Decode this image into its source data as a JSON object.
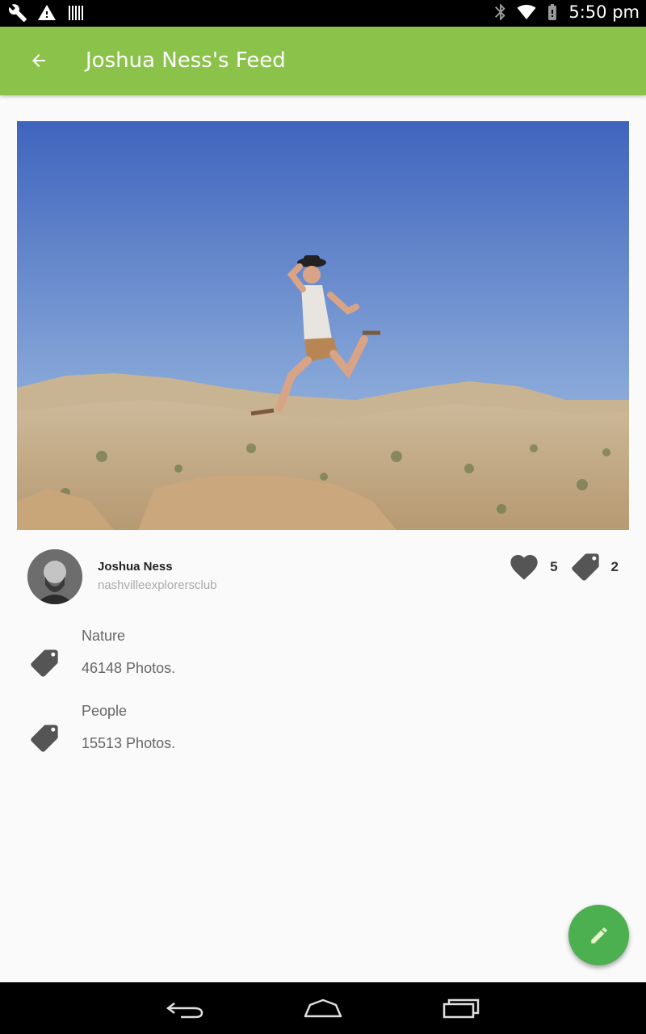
{
  "status_bar": {
    "time": "5:50 pm",
    "left_icons": [
      "wrench-icon",
      "warning-icon",
      "barcode-icon"
    ],
    "right_icons": [
      "bluetooth-icon",
      "wifi-icon",
      "battery-icon"
    ]
  },
  "app_bar": {
    "title": "Joshua Ness's Feed",
    "back_icon": "arrow-left-icon",
    "color": "#8bc34a"
  },
  "photo": {
    "description_icon": "photo-image"
  },
  "author": {
    "name": "Joshua Ness",
    "username": "nashvilleexplorersclub"
  },
  "stats": {
    "likes": "5",
    "tags": "2"
  },
  "tags": [
    {
      "name": "Nature",
      "count": "46148 Photos."
    },
    {
      "name": "People",
      "count": "15513 Photos."
    }
  ],
  "fab": {
    "icon": "pencil-icon",
    "color": "#4caf50"
  },
  "nav_bar": {
    "icons": [
      "back-nav-icon",
      "home-nav-icon",
      "recents-nav-icon"
    ]
  }
}
